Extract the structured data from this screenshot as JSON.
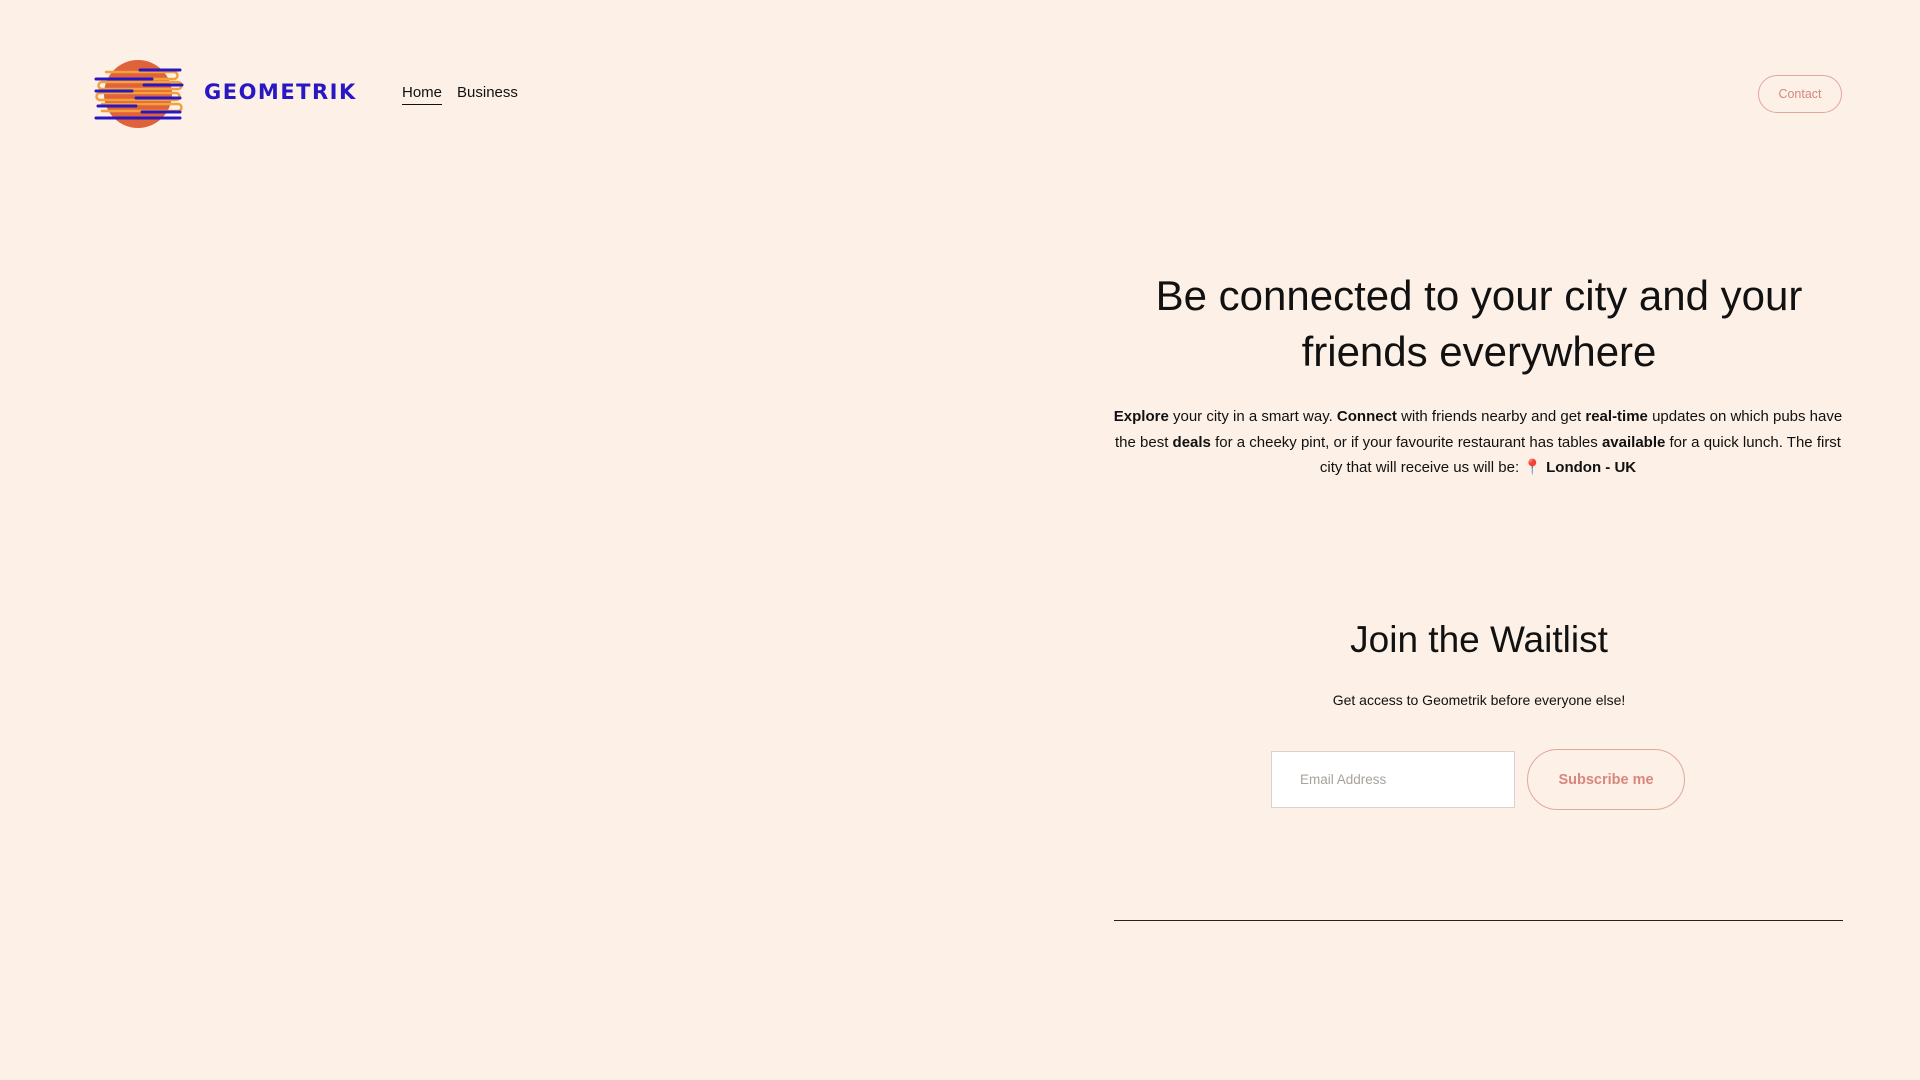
{
  "header": {
    "brand_name": "GEOMETRIK",
    "nav": [
      {
        "label": "Home",
        "active": true
      },
      {
        "label": "Business",
        "active": false
      }
    ],
    "contact_label": "Contact"
  },
  "hero": {
    "title": "Be connected to your city and your friends everywhere",
    "text": {
      "explore": "Explore",
      "t1": " your city in a smart way. ",
      "connect": "Connect",
      "t2": " with friends nearby and get ",
      "realtime": "real-time",
      "t3": " updates on which pubs have the best ",
      "deals": "deals",
      "t4": " for a cheeky pint, or if your favourite restaurant has tables ",
      "available": "available",
      "t5": " for a quick lunch. The first city that will receive us will be: ",
      "pin": "📍",
      "city": "London - UK"
    }
  },
  "waitlist": {
    "title": "Join the Waitlist",
    "subtitle": "Get access to Geometrik before everyone else!",
    "email_placeholder": "Email Address",
    "subscribe_label": "Subscribe me"
  },
  "colors": {
    "background": "#fcf0e7",
    "brand": "#2a17c4",
    "accent": "#d8877d",
    "logo_circle": "#e0623a",
    "logo_rings": "#f2a23a"
  },
  "icons": {
    "logo": "geometrik-logo-icon",
    "pin": "map-pin-icon"
  }
}
